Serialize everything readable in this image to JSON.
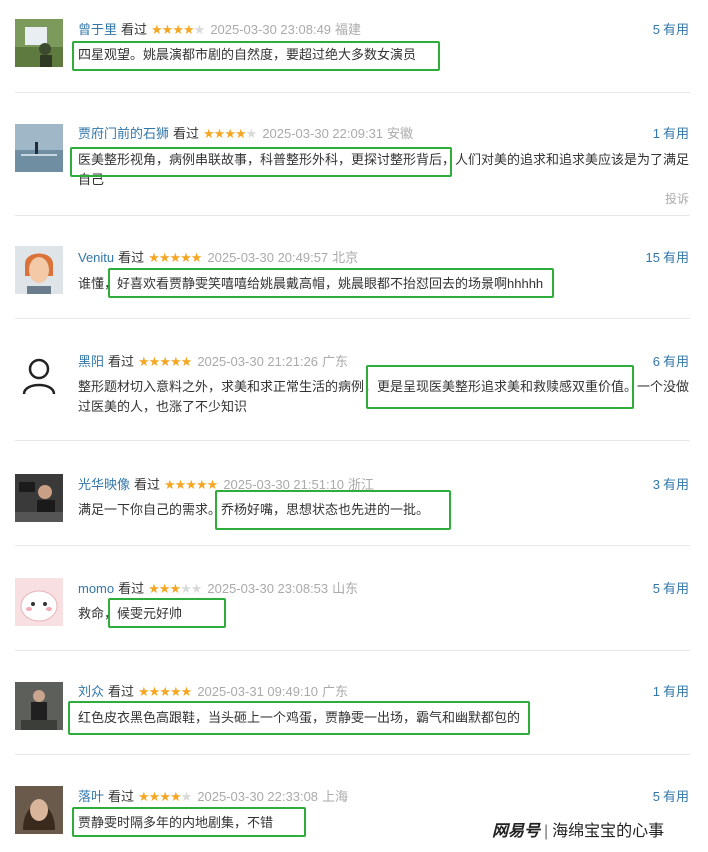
{
  "comments": [
    {
      "user": "曾于里",
      "status": "看过",
      "rating": 4,
      "time": "2025-03-30 23:08:49",
      "location": "福建",
      "votes": "5",
      "useful_label": "有用",
      "text": "四星观望。姚晨演都市剧的自然度，要超过绝大多数女演员"
    },
    {
      "user": "贾府门前的石狮",
      "status": "看过",
      "rating": 4,
      "time": "2025-03-30 22:09:31",
      "location": "安徽",
      "votes": "1",
      "useful_label": "有用",
      "text": "医美整形视角，病例串联故事，科普整形外科，更探讨整形背后，人们对美的追求和追求美应该是为了满足自己",
      "report": "投诉"
    },
    {
      "user": "Venitu",
      "status": "看过",
      "rating": 5,
      "time": "2025-03-30 20:49:57",
      "location": "北京",
      "votes": "15",
      "useful_label": "有用",
      "text": "谁懂，好喜欢看贾静雯笑嘻嘻给姚晨戴高帽，姚晨眼都不抬怼回去的场景啊hhhhh"
    },
    {
      "user": "黑阳",
      "status": "看过",
      "rating": 5,
      "time": "2025-03-30 21:21:26",
      "location": "广东",
      "votes": "6",
      "useful_label": "有用",
      "text": "整形题材切入意料之外，求美和求正常生活的病例，更是呈现医美整形追求美和救赎感双重价值。一个没做过医美的人，也涨了不少知识"
    },
    {
      "user": "光华映像",
      "status": "看过",
      "rating": 5,
      "time": "2025-03-30 21:51:10",
      "location": "浙江",
      "votes": "3",
      "useful_label": "有用",
      "text": "满足一下你自己的需求。乔杨好嘴，思想状态也先进的一批。"
    },
    {
      "user": "momo",
      "status": "看过",
      "rating": 3,
      "time": "2025-03-30 23:08:53",
      "location": "山东",
      "votes": "5",
      "useful_label": "有用",
      "text": "救命，候雯元好帅"
    },
    {
      "user": "刘众",
      "status": "看过",
      "rating": 5,
      "time": "2025-03-31 09:49:10",
      "location": "广东",
      "votes": "1",
      "useful_label": "有用",
      "text": "红色皮衣黑色高跟鞋，当头砸上一个鸡蛋，贾静雯一出场，霸气和幽默都包的"
    },
    {
      "user": "落叶",
      "status": "看过",
      "rating": 4,
      "time": "2025-03-30 22:33:08",
      "location": "上海",
      "votes": "5",
      "useful_label": "有用",
      "text": "贾静雯时隔多年的内地剧集，不错"
    }
  ],
  "watermark": {
    "logo": "网易号",
    "separator": "|",
    "author": "海绵宝宝的心事"
  },
  "colors": {
    "accent": "#3377aa",
    "star": "#f5a623",
    "highlight": "#2fad3a"
  },
  "icons": [
    "avatar-photo",
    "avatar-default-user-icon",
    "star-icon"
  ]
}
